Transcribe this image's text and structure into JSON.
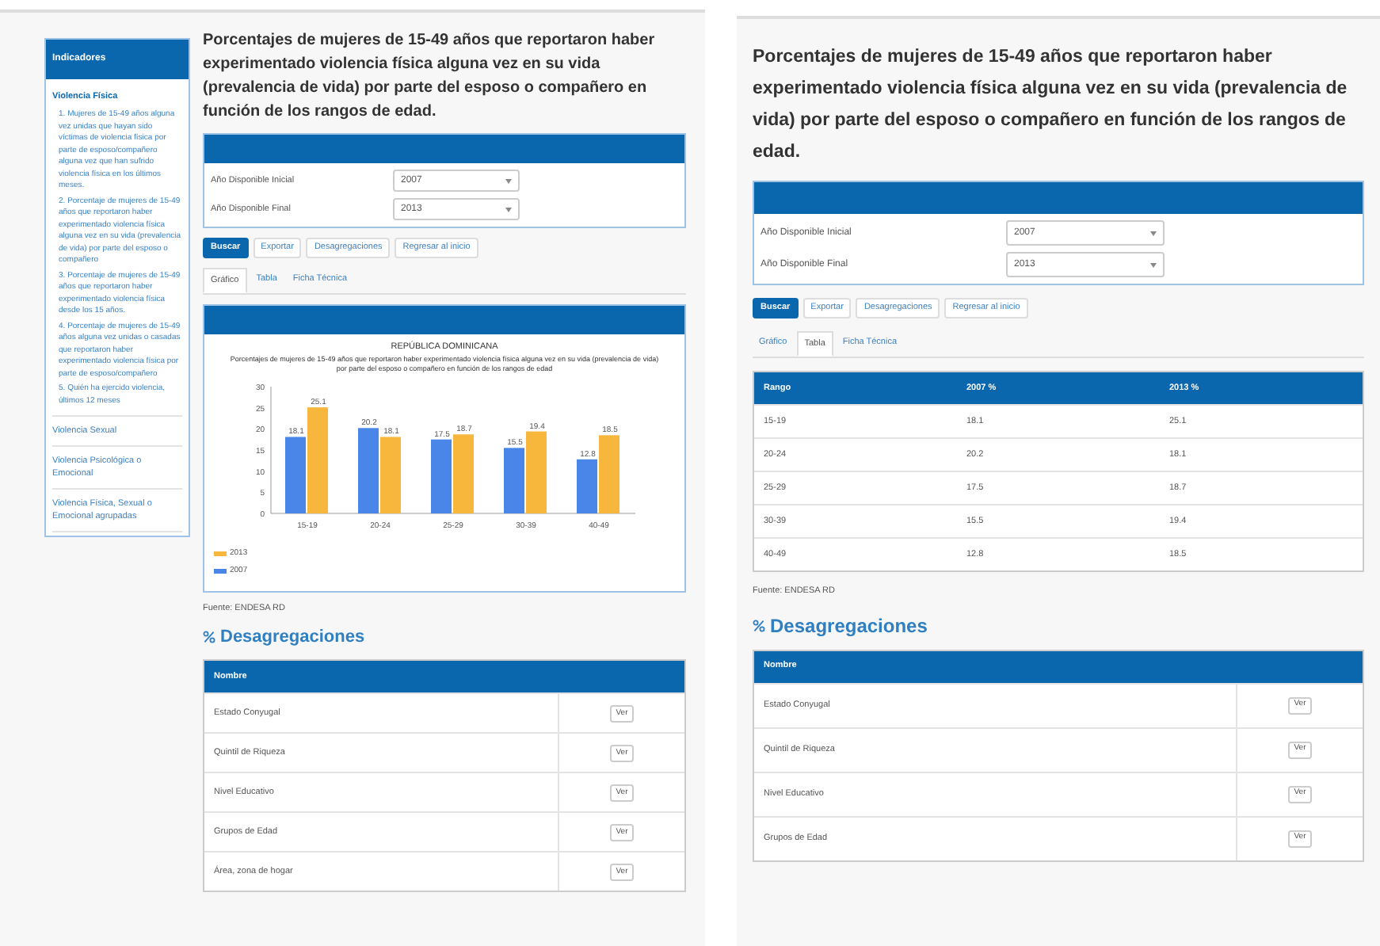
{
  "left_view": {
    "sidebar": {
      "title": "Indicadores",
      "items": [
        {
          "label": "Violencia Física",
          "expanded": true,
          "children": [
            {
              "number": "1.",
              "label": "Mujeres de 15-49 años alguna vez unidas que hayan sido víctimas de violencia física por parte de esposo/compañero alguna vez que han sufrido violencia física en los últimos meses."
            },
            {
              "number": "2.",
              "label": "Porcentaje de mujeres de 15-49 años que reportaron haber experimentado violencia física alguna vez en su vida (prevalencia de vida) por parte del esposo o compañero"
            },
            {
              "number": "3.",
              "label": "Porcentaje de mujeres de 15-49 años que reportaron haber experimentado violencia física desde los 15 años."
            },
            {
              "number": "4.",
              "label": "Porcentaje de mujeres de 15-49 años alguna vez unidas o casadas que reportaron haber experimentado violencia física por parte de esposo/compañero"
            },
            {
              "number": "5.",
              "label": "Quién ha ejercido violencia, últimos 12 meses"
            }
          ]
        },
        {
          "label": "Violencia Sexual",
          "expanded": false
        },
        {
          "label": "Violencia Psicológica o Emocional",
          "expanded": false
        },
        {
          "label": "Violencia Física, Sexual o Emocional agrupadas",
          "expanded": false
        }
      ]
    },
    "title": "Porcentajes de mujeres de 15-49 años que reportaron haber experimentado violencia física alguna vez en su vida (prevalencia de vida) por parte del esposo o compañero en función de los rangos de edad.",
    "filters": [
      {
        "label": "Año Disponible Inicial",
        "value": "2007"
      },
      {
        "label": "Año Disponible Final",
        "value": "2013"
      }
    ],
    "buttons": [
      {
        "label": "Buscar",
        "kind": "primary"
      },
      {
        "label": "Exportar",
        "kind": "default"
      },
      {
        "label": "Desagregaciones",
        "kind": "default"
      },
      {
        "label": "Regresar al inicio",
        "kind": "default"
      }
    ],
    "tabs": [
      {
        "label": "Gráfico",
        "selected": true
      },
      {
        "label": "Tabla",
        "selected": false
      },
      {
        "label": "Ficha Técnica",
        "selected": false
      }
    ],
    "chart_panel": {
      "subtitle": "Porcentajes de mujeres de 15-49 años que reportaron haber experimentado violencia física alguna vez en su vida (prevalencia de vida) por parte del esposo o compañero en función de los rangos de edad",
      "chart_data": {
        "type": "bar",
        "title": "REPÚBLICA DOMINICANA",
        "categories": [
          "15-19",
          "20-24",
          "25-29",
          "30-39",
          "40-49"
        ],
        "series": [
          {
            "name": "2007",
            "color": "#4a86e8",
            "values": [
              18.1,
              20.2,
              17.5,
              15.5,
              12.8
            ]
          },
          {
            "name": "2013",
            "color": "#f6b73c",
            "values": [
              25.1,
              18.1,
              18.7,
              19.4,
              18.5
            ]
          }
        ],
        "ylim": [
          0,
          30
        ],
        "yticks": [
          0,
          5,
          10,
          15,
          20,
          25,
          30
        ],
        "data_labels": true
      }
    },
    "source": "Fuente: ENDESA RD",
    "disaggregations": {
      "heading": "Desagregaciones",
      "column": "Nombre",
      "rows": [
        {
          "name": "Estado Conyugal",
          "action": "Ver"
        },
        {
          "name": "Quintil de Riqueza",
          "action": "Ver"
        },
        {
          "name": "Nivel Educativo",
          "action": "Ver"
        },
        {
          "name": "Grupos de Edad",
          "action": "Ver"
        },
        {
          "name": "Área, zona de hogar",
          "action": "Ver"
        }
      ]
    }
  },
  "right_view": {
    "title": "Porcentajes de mujeres de 15-49 años que reportaron haber experimentado violencia física alguna vez en su vida (prevalencia de vida) por parte del esposo o compañero en función de los rangos de edad.",
    "filters": [
      {
        "label": "Año Disponible Inicial",
        "value": "2007"
      },
      {
        "label": "Año Disponible Final",
        "value": "2013"
      }
    ],
    "buttons": [
      {
        "label": "Buscar",
        "kind": "primary"
      },
      {
        "label": "Exportar",
        "kind": "default"
      },
      {
        "label": "Desagregaciones",
        "kind": "default"
      },
      {
        "label": "Regresar al inicio",
        "kind": "default"
      }
    ],
    "tabs": [
      {
        "label": "Gráfico",
        "selected": false
      },
      {
        "label": "Tabla",
        "selected": true
      },
      {
        "label": "Ficha Técnica",
        "selected": false
      }
    ],
    "table": {
      "columns": [
        "Rango",
        "2007 %",
        "2013 %"
      ],
      "rows": [
        [
          "15-19",
          "18.1",
          "25.1"
        ],
        [
          "20-24",
          "20.2",
          "18.1"
        ],
        [
          "25-29",
          "17.5",
          "18.7"
        ],
        [
          "30-39",
          "15.5",
          "19.4"
        ],
        [
          "40-49",
          "12.8",
          "18.5"
        ]
      ]
    },
    "source": "Fuente: ENDESA RD",
    "disaggregations": {
      "heading": "Desagregaciones",
      "column": "Nombre",
      "rows": [
        {
          "name": "Estado Conyugal",
          "action": "Ver"
        },
        {
          "name": "Quintil de Riqueza",
          "action": "Ver"
        },
        {
          "name": "Nivel Educativo",
          "action": "Ver"
        },
        {
          "name": "Grupos de Edad",
          "action": "Ver"
        }
      ]
    }
  }
}
